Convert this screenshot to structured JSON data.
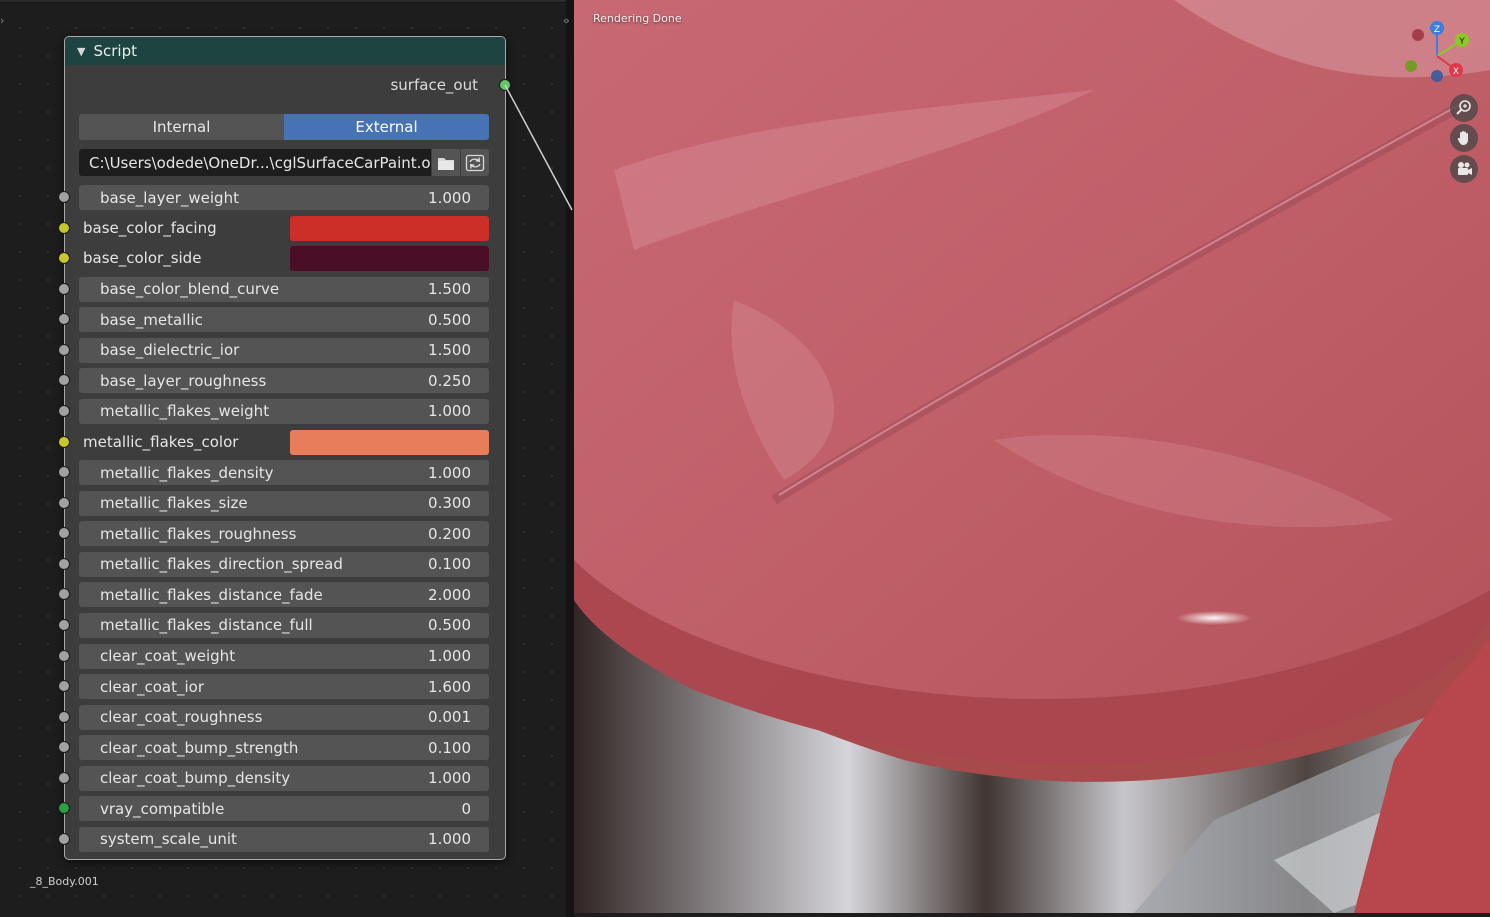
{
  "node": {
    "title": "Script",
    "output": "surface_out",
    "tabs": [
      {
        "label": "Internal",
        "active": false
      },
      {
        "label": "External",
        "active": true
      }
    ],
    "filepath": "C:\\Users\\odede\\OneDr...\\cglSurfaceCarPaint.osl",
    "properties": [
      {
        "name": "base_layer_weight",
        "value": "1.000",
        "kind": "number",
        "socket": "gray"
      },
      {
        "name": "base_color_facing",
        "value": "",
        "kind": "color",
        "color": "#cc2f27",
        "socket": "yellow"
      },
      {
        "name": "base_color_side",
        "value": "",
        "kind": "color",
        "color": "#4a0f26",
        "socket": "yellow"
      },
      {
        "name": "base_color_blend_curve",
        "value": "1.500",
        "kind": "number",
        "socket": "gray"
      },
      {
        "name": "base_metallic",
        "value": "0.500",
        "kind": "number",
        "socket": "gray"
      },
      {
        "name": "base_dielectric_ior",
        "value": "1.500",
        "kind": "number",
        "socket": "gray"
      },
      {
        "name": "base_layer_roughness",
        "value": "0.250",
        "kind": "number",
        "socket": "gray"
      },
      {
        "name": "metallic_flakes_weight",
        "value": "1.000",
        "kind": "number",
        "socket": "gray"
      },
      {
        "name": "metallic_flakes_color",
        "value": "",
        "kind": "color",
        "color": "#e87d5c",
        "socket": "yellow"
      },
      {
        "name": "metallic_flakes_density",
        "value": "1.000",
        "kind": "number",
        "socket": "gray"
      },
      {
        "name": "metallic_flakes_size",
        "value": "0.300",
        "kind": "number",
        "socket": "gray"
      },
      {
        "name": "metallic_flakes_roughness",
        "value": "0.200",
        "kind": "number",
        "socket": "gray"
      },
      {
        "name": "metallic_flakes_direction_spread",
        "value": "0.100",
        "kind": "number",
        "socket": "gray"
      },
      {
        "name": "metallic_flakes_distance_fade",
        "value": "2.000",
        "kind": "number",
        "socket": "gray"
      },
      {
        "name": "metallic_flakes_distance_full",
        "value": "0.500",
        "kind": "number",
        "socket": "gray"
      },
      {
        "name": "clear_coat_weight",
        "value": "1.000",
        "kind": "number",
        "socket": "gray"
      },
      {
        "name": "clear_coat_ior",
        "value": "1.600",
        "kind": "number",
        "socket": "gray"
      },
      {
        "name": "clear_coat_roughness",
        "value": "0.001",
        "kind": "number",
        "socket": "gray"
      },
      {
        "name": "clear_coat_bump_strength",
        "value": "0.100",
        "kind": "number",
        "socket": "gray"
      },
      {
        "name": "clear_coat_bump_density",
        "value": "1.000",
        "kind": "number",
        "socket": "gray"
      },
      {
        "name": "vray_compatible",
        "value": "0",
        "kind": "number",
        "socket": "dkgreen"
      },
      {
        "name": "system_scale_unit",
        "value": "1.000",
        "kind": "number",
        "socket": "gray"
      }
    ]
  },
  "status": {
    "object_name": "_8_Body.001",
    "render_status": "Rendering Done"
  },
  "gizmo": {
    "axes": [
      {
        "label": "Z",
        "color": "#3b7de0"
      },
      {
        "label": "Y",
        "color": "#8ac926"
      },
      {
        "label": "X",
        "color": "#e0374a"
      }
    ]
  },
  "icons": {
    "zoom": "zoom-icon",
    "pan": "hand-icon",
    "camera": "camera-icon",
    "folder": "folder-icon",
    "reload": "reload-icon"
  }
}
